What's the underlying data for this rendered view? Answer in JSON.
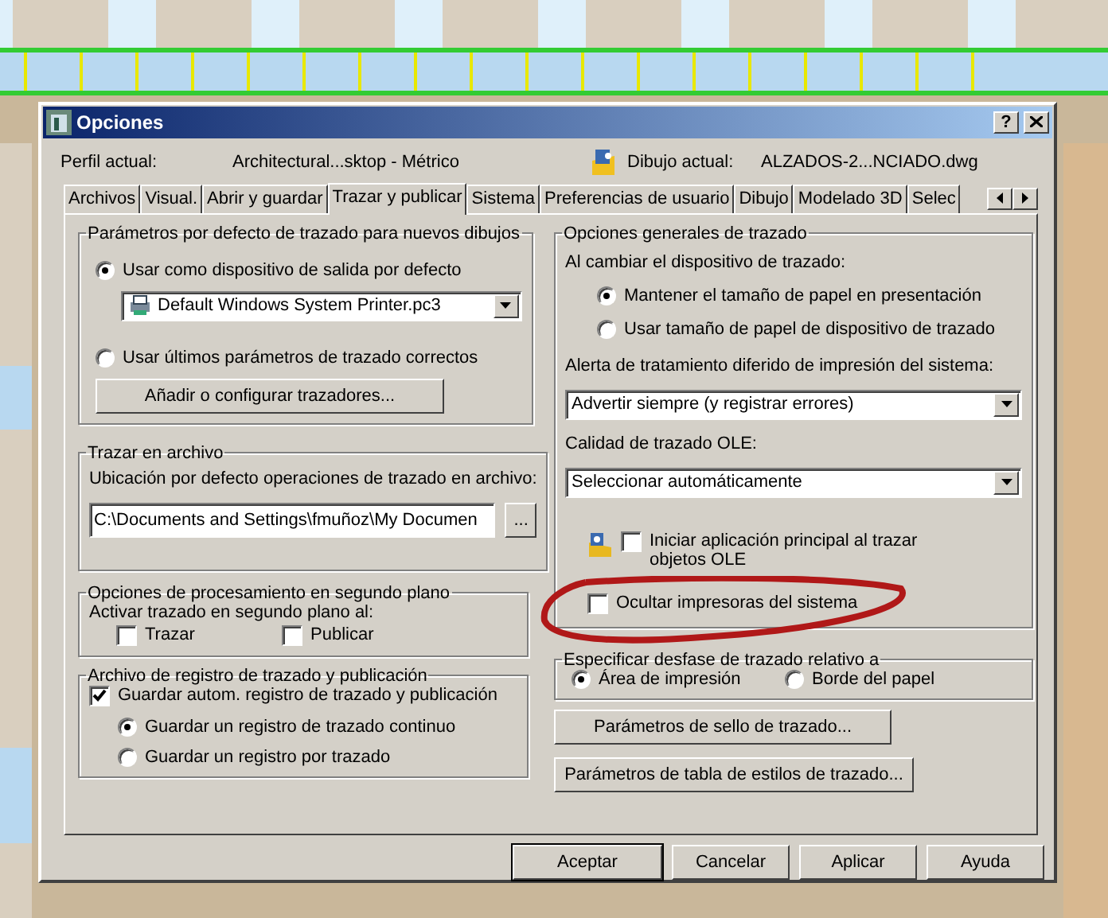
{
  "window": {
    "title": "Opciones",
    "help_button": "?"
  },
  "profile": {
    "label": "Perfil actual:",
    "value": "Architectural...sktop - Métrico"
  },
  "drawing": {
    "label": "Dibujo actual:",
    "value": "ALZADOS-2...NCIADO.dwg"
  },
  "tabs": [
    {
      "label": "Archivos",
      "selected": false
    },
    {
      "label": "Visual.",
      "selected": false
    },
    {
      "label": "Abrir y guardar",
      "selected": false
    },
    {
      "label": "Trazar y publicar",
      "selected": true
    },
    {
      "label": "Sistema",
      "selected": false
    },
    {
      "label": "Preferencias de usuario",
      "selected": false
    },
    {
      "label": "Dibujo",
      "selected": false
    },
    {
      "label": "Modelado 3D",
      "selected": false
    },
    {
      "label": "Selec",
      "selected": false
    }
  ],
  "plot_defaults": {
    "title": "Parámetros por defecto de trazado para nuevos dibujos",
    "options": [
      {
        "label": "Usar como dispositivo de salida por defecto",
        "selected": true
      },
      {
        "label": "Usar últimos parámetros de trazado correctos",
        "selected": false
      }
    ],
    "device": "Default Windows System Printer.pc3",
    "button": "Añadir o configurar trazadores..."
  },
  "plot_to_file": {
    "title": "Trazar en archivo",
    "label": "Ubicación por defecto operaciones de trazado en archivo:",
    "path": "C:\\Documents and Settings\\fmuñoz\\My Documen",
    "browse_button": "..."
  },
  "background": {
    "title": "Opciones de procesamiento en segundo plano",
    "label": "Activar trazado en segundo plano al:",
    "checkboxes": [
      {
        "label": "Trazar",
        "checked": false
      },
      {
        "label": "Publicar",
        "checked": false
      }
    ]
  },
  "log": {
    "title": "Archivo de registro de trazado y publicación",
    "auto_save": {
      "label": "Guardar autom. registro de trazado y publicación",
      "checked": true
    },
    "options": [
      {
        "label": "Guardar un registro de trazado continuo",
        "selected": true
      },
      {
        "label": "Guardar un registro por trazado",
        "selected": false
      }
    ]
  },
  "general": {
    "title": "Opciones generales de trazado",
    "device_change_label": "Al cambiar el dispositivo de trazado:",
    "options": [
      {
        "label": "Mantener el tamaño de papel en presentación",
        "selected": true
      },
      {
        "label": "Usar tamaño de papel de dispositivo de trazado",
        "selected": false
      }
    ],
    "spool_label": "Alerta de tratamiento diferido de impresión del sistema:",
    "spool_value": "Advertir siempre (y registrar errores)",
    "ole_label": "Calidad de trazado OLE:",
    "ole_value": "Seleccionar automáticamente",
    "ole_start": {
      "label": "Iniciar aplicación principal al trazar objetos OLE",
      "checked": false
    },
    "hide_printers": {
      "label": "Ocultar impresoras del sistema",
      "checked": false
    }
  },
  "offset": {
    "title": "Especificar desfase de trazado relativo a",
    "options": [
      {
        "label": "Área de impresión",
        "selected": true
      },
      {
        "label": "Borde del papel",
        "selected": false
      }
    ]
  },
  "side_buttons": [
    "Parámetros de sello de trazado...",
    "Parámetros de tabla de estilos de trazado..."
  ],
  "footer_buttons": [
    {
      "label": "Aceptar",
      "default": true
    },
    {
      "label": "Cancelar",
      "default": false
    },
    {
      "label": "Aplicar",
      "default": false
    },
    {
      "label": "Ayuda",
      "default": false
    }
  ]
}
